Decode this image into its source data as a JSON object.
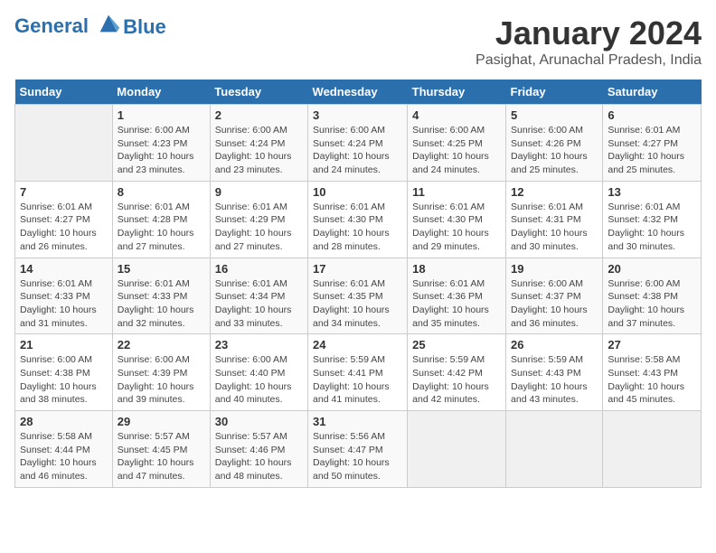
{
  "header": {
    "logo_line1": "General",
    "logo_line2": "Blue",
    "title": "January 2024",
    "subtitle": "Pasighat, Arunachal Pradesh, India"
  },
  "calendar": {
    "days_of_week": [
      "Sunday",
      "Monday",
      "Tuesday",
      "Wednesday",
      "Thursday",
      "Friday",
      "Saturday"
    ],
    "weeks": [
      [
        {
          "day": "",
          "info": ""
        },
        {
          "day": "1",
          "info": "Sunrise: 6:00 AM\nSunset: 4:23 PM\nDaylight: 10 hours\nand 23 minutes."
        },
        {
          "day": "2",
          "info": "Sunrise: 6:00 AM\nSunset: 4:24 PM\nDaylight: 10 hours\nand 23 minutes."
        },
        {
          "day": "3",
          "info": "Sunrise: 6:00 AM\nSunset: 4:24 PM\nDaylight: 10 hours\nand 24 minutes."
        },
        {
          "day": "4",
          "info": "Sunrise: 6:00 AM\nSunset: 4:25 PM\nDaylight: 10 hours\nand 24 minutes."
        },
        {
          "day": "5",
          "info": "Sunrise: 6:00 AM\nSunset: 4:26 PM\nDaylight: 10 hours\nand 25 minutes."
        },
        {
          "day": "6",
          "info": "Sunrise: 6:01 AM\nSunset: 4:27 PM\nDaylight: 10 hours\nand 25 minutes."
        }
      ],
      [
        {
          "day": "7",
          "info": "Sunrise: 6:01 AM\nSunset: 4:27 PM\nDaylight: 10 hours\nand 26 minutes."
        },
        {
          "day": "8",
          "info": "Sunrise: 6:01 AM\nSunset: 4:28 PM\nDaylight: 10 hours\nand 27 minutes."
        },
        {
          "day": "9",
          "info": "Sunrise: 6:01 AM\nSunset: 4:29 PM\nDaylight: 10 hours\nand 27 minutes."
        },
        {
          "day": "10",
          "info": "Sunrise: 6:01 AM\nSunset: 4:30 PM\nDaylight: 10 hours\nand 28 minutes."
        },
        {
          "day": "11",
          "info": "Sunrise: 6:01 AM\nSunset: 4:30 PM\nDaylight: 10 hours\nand 29 minutes."
        },
        {
          "day": "12",
          "info": "Sunrise: 6:01 AM\nSunset: 4:31 PM\nDaylight: 10 hours\nand 30 minutes."
        },
        {
          "day": "13",
          "info": "Sunrise: 6:01 AM\nSunset: 4:32 PM\nDaylight: 10 hours\nand 30 minutes."
        }
      ],
      [
        {
          "day": "14",
          "info": "Sunrise: 6:01 AM\nSunset: 4:33 PM\nDaylight: 10 hours\nand 31 minutes."
        },
        {
          "day": "15",
          "info": "Sunrise: 6:01 AM\nSunset: 4:33 PM\nDaylight: 10 hours\nand 32 minutes."
        },
        {
          "day": "16",
          "info": "Sunrise: 6:01 AM\nSunset: 4:34 PM\nDaylight: 10 hours\nand 33 minutes."
        },
        {
          "day": "17",
          "info": "Sunrise: 6:01 AM\nSunset: 4:35 PM\nDaylight: 10 hours\nand 34 minutes."
        },
        {
          "day": "18",
          "info": "Sunrise: 6:01 AM\nSunset: 4:36 PM\nDaylight: 10 hours\nand 35 minutes."
        },
        {
          "day": "19",
          "info": "Sunrise: 6:00 AM\nSunset: 4:37 PM\nDaylight: 10 hours\nand 36 minutes."
        },
        {
          "day": "20",
          "info": "Sunrise: 6:00 AM\nSunset: 4:38 PM\nDaylight: 10 hours\nand 37 minutes."
        }
      ],
      [
        {
          "day": "21",
          "info": "Sunrise: 6:00 AM\nSunset: 4:38 PM\nDaylight: 10 hours\nand 38 minutes."
        },
        {
          "day": "22",
          "info": "Sunrise: 6:00 AM\nSunset: 4:39 PM\nDaylight: 10 hours\nand 39 minutes."
        },
        {
          "day": "23",
          "info": "Sunrise: 6:00 AM\nSunset: 4:40 PM\nDaylight: 10 hours\nand 40 minutes."
        },
        {
          "day": "24",
          "info": "Sunrise: 5:59 AM\nSunset: 4:41 PM\nDaylight: 10 hours\nand 41 minutes."
        },
        {
          "day": "25",
          "info": "Sunrise: 5:59 AM\nSunset: 4:42 PM\nDaylight: 10 hours\nand 42 minutes."
        },
        {
          "day": "26",
          "info": "Sunrise: 5:59 AM\nSunset: 4:43 PM\nDaylight: 10 hours\nand 43 minutes."
        },
        {
          "day": "27",
          "info": "Sunrise: 5:58 AM\nSunset: 4:43 PM\nDaylight: 10 hours\nand 45 minutes."
        }
      ],
      [
        {
          "day": "28",
          "info": "Sunrise: 5:58 AM\nSunset: 4:44 PM\nDaylight: 10 hours\nand 46 minutes."
        },
        {
          "day": "29",
          "info": "Sunrise: 5:57 AM\nSunset: 4:45 PM\nDaylight: 10 hours\nand 47 minutes."
        },
        {
          "day": "30",
          "info": "Sunrise: 5:57 AM\nSunset: 4:46 PM\nDaylight: 10 hours\nand 48 minutes."
        },
        {
          "day": "31",
          "info": "Sunrise: 5:56 AM\nSunset: 4:47 PM\nDaylight: 10 hours\nand 50 minutes."
        },
        {
          "day": "",
          "info": ""
        },
        {
          "day": "",
          "info": ""
        },
        {
          "day": "",
          "info": ""
        }
      ]
    ]
  }
}
